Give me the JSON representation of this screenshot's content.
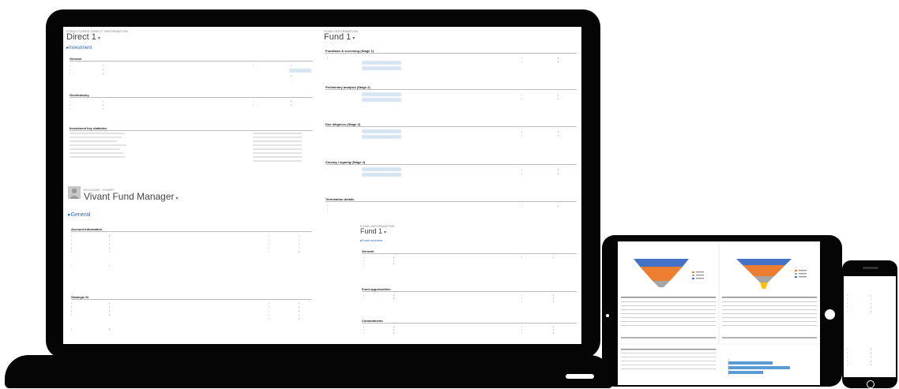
{
  "direct": {
    "crumb": "STRUCTURED DIRECT INFORMATION",
    "title": "Direct 1",
    "tab": "Investment",
    "sections": [
      "General",
      "Geo/industry",
      "Investment key statistics"
    ]
  },
  "manager": {
    "crumb": "ACCOUNT: VIVANT",
    "title": "Vivant Fund Manager",
    "tab": "General",
    "sections": [
      "Account information",
      "Strategic fit"
    ]
  },
  "fund": {
    "crumb": "FUND INFORMATION",
    "title": "Fund 1",
    "sections": [
      "Fundraise & screening (Stage 1)",
      "Preliminary analysis (Stage 2)",
      "Due diligence (Stage 3)",
      "Closing / signing (Stage 4)",
      "Termination details"
    ]
  },
  "fund_small": {
    "crumb": "FUND INFORMATION",
    "title": "Fund 1",
    "tab": "Fund overview",
    "sections": [
      "General",
      "Fund opportunities",
      "Commitments"
    ]
  },
  "colors": {
    "funnel_top": "#4472c4",
    "funnel_mid": "#ed7d31",
    "funnel_low": "#a5a5a5",
    "funnel_tip": "#ffc000",
    "bar": "#5b9bd5",
    "link": "#2266cc"
  }
}
